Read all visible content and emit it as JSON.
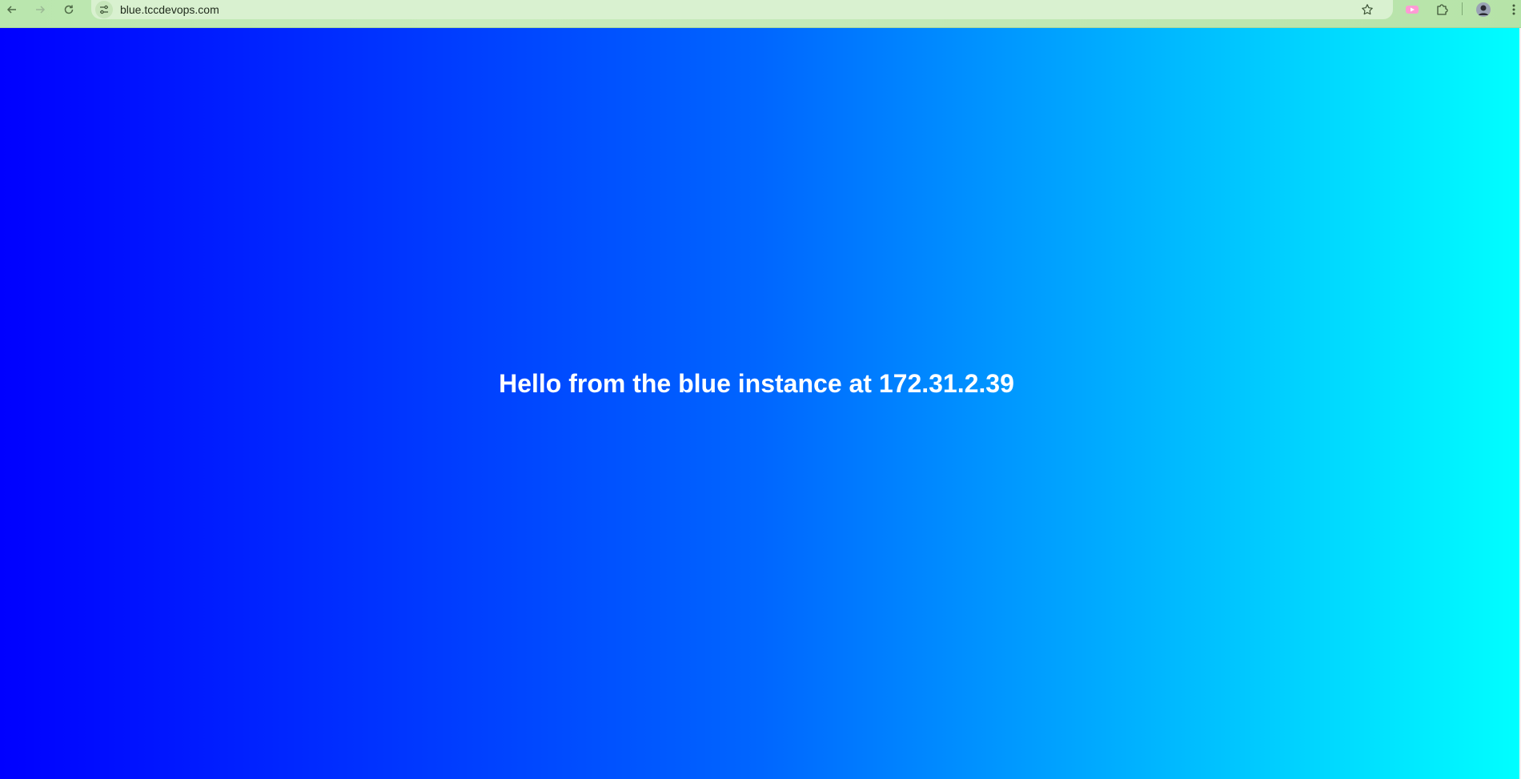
{
  "browser": {
    "url": "blue.tccdevops.com",
    "icons": {
      "back": "back-arrow-icon",
      "forward": "forward-arrow-icon",
      "reload": "reload-icon",
      "site_info": "site-settings-icon",
      "bookmark": "star-icon",
      "extension_1": "pink-extension-icon",
      "extensions": "puzzle-icon",
      "profile": "avatar-icon",
      "menu": "kebab-menu-icon"
    }
  },
  "page": {
    "message": "Hello from the blue instance at 172.31.2.39",
    "gradient": [
      "#0000ff",
      "#0066ff",
      "#00ffff"
    ]
  }
}
